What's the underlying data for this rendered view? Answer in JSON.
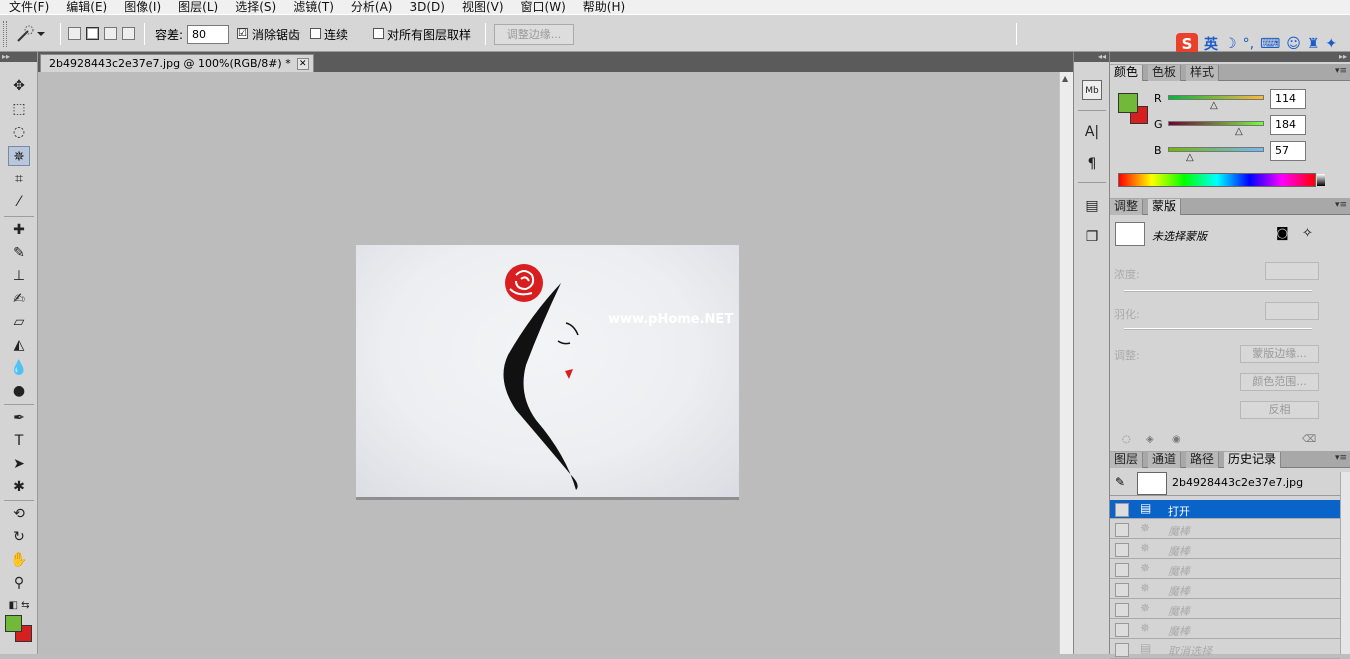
{
  "menu": [
    "文件(F)",
    "编辑(E)",
    "图像(I)",
    "图层(L)",
    "选择(S)",
    "滤镜(T)",
    "分析(A)",
    "3D(D)",
    "视图(V)",
    "窗口(W)",
    "帮助(H)"
  ],
  "options": {
    "tolerance_label": "容差:",
    "tolerance_value": "80",
    "antialias_label": "消除锯齿",
    "antialias_checked": "☑",
    "contiguous_label": "连续",
    "all_layers_label": "对所有图层取样",
    "refine_edge_label": "调整边缘..."
  },
  "ime": {
    "logo": "S",
    "lang": "英"
  },
  "document": {
    "tab_title": "2b4928443c2e37e7.jpg @ 100%(RGB/8#) *",
    "close": "✕",
    "watermark": "www.pHome.NET"
  },
  "color_panel": {
    "tabs": [
      "颜色",
      "色板",
      "样式"
    ],
    "fg_color": "#72b839",
    "bg_color": "#d62020",
    "r_label": "R",
    "r_value": "114",
    "g_label": "G",
    "g_value": "184",
    "b_label": "B",
    "b_value": "57"
  },
  "mask_panel": {
    "tabs": [
      "调整",
      "蒙版"
    ],
    "title": "未选择蒙版",
    "density_label": "浓度:",
    "feather_label": "羽化:",
    "refine_label": "调整:",
    "mask_edge_btn": "蒙版边缘...",
    "color_range_btn": "颜色范围...",
    "invert_btn": "反相"
  },
  "history_panel": {
    "tabs": [
      "图层",
      "通道",
      "路径",
      "历史记录"
    ],
    "snapshot_name": "2b4928443c2e37e7.jpg",
    "rows": [
      "打开",
      "魔棒",
      "魔棒",
      "魔棒",
      "魔棒",
      "魔棒",
      "魔棒",
      "取消选择"
    ]
  }
}
